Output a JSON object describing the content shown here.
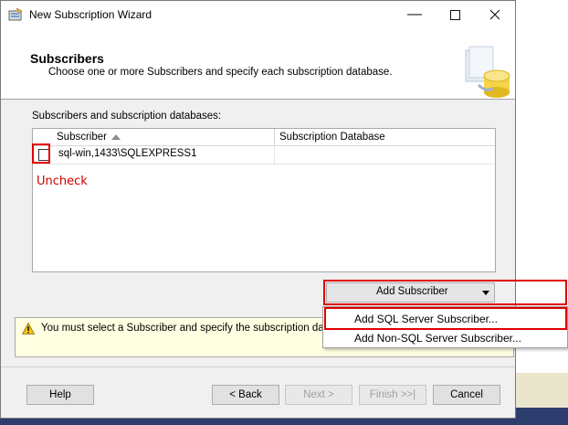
{
  "window": {
    "title": "New Subscription Wizard",
    "minimize_icon": "minimize-icon",
    "maximize_icon": "maximize-icon",
    "close_icon": "close-icon"
  },
  "header": {
    "title": "Subscribers",
    "subtitle": "Choose one or more Subscribers and specify each subscription database."
  },
  "grid": {
    "section_label": "Subscribers and subscription databases:",
    "columns": [
      "Subscriber",
      "Subscription Database"
    ],
    "rows": [
      {
        "checked": false,
        "subscriber": "sql-win,1433\\SQLEXPRESS1",
        "database": ""
      }
    ]
  },
  "annotation": "Uncheck",
  "add_subscriber": {
    "label": "Add Subscriber",
    "menu": [
      "Add SQL Server Subscriber...",
      "Add Non-SQL Server Subscriber..."
    ]
  },
  "warning": {
    "text": "You must select a Subscriber and specify the subscription databas"
  },
  "footer": {
    "help": "Help",
    "back": "< Back",
    "next": "Next >",
    "finish": "Finish >>|",
    "cancel": "Cancel"
  },
  "colors": {
    "highlight_red": "#e00000",
    "warning_bg": "#ffffe1"
  }
}
